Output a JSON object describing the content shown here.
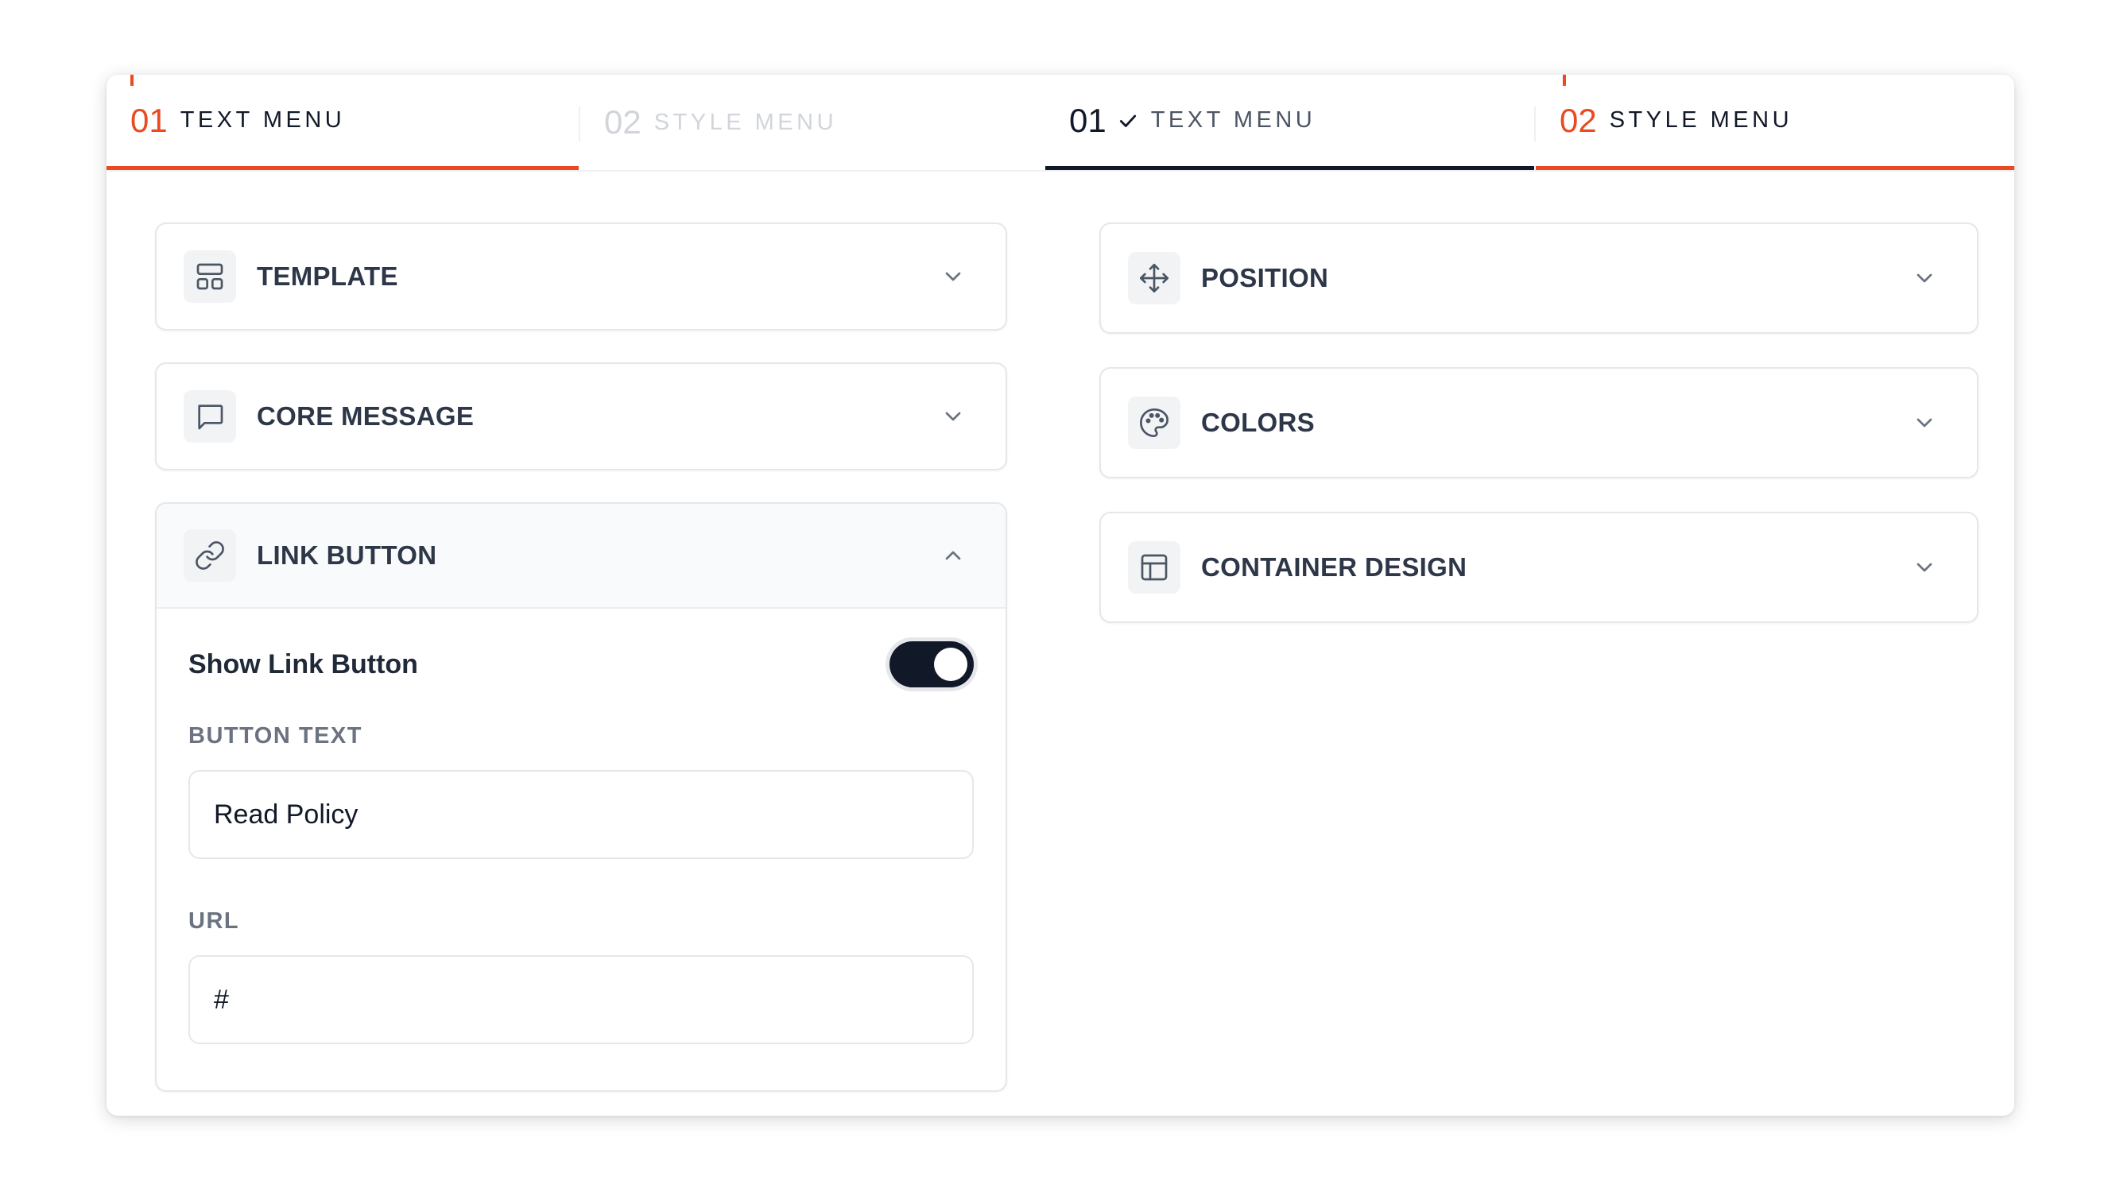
{
  "left_panel": {
    "tabs": [
      {
        "num": "01",
        "label": "TEXT MENU"
      },
      {
        "num": "02",
        "label": "STYLE MENU"
      }
    ],
    "sections": {
      "template": {
        "title": "TEMPLATE",
        "icon": "layout-template-icon"
      },
      "core_message": {
        "title": "CORE MESSAGE",
        "icon": "message-square-icon"
      },
      "link_button": {
        "title": "LINK BUTTON",
        "icon": "link-icon",
        "show_label": "Show Link Button",
        "show_enabled": true,
        "button_text_label": "BUTTON TEXT",
        "button_text_value": "Read Policy",
        "url_label": "URL",
        "url_value": "#"
      }
    }
  },
  "right_panel": {
    "tabs": [
      {
        "num": "01",
        "label": "TEXT MENU",
        "completed": true
      },
      {
        "num": "02",
        "label": "STYLE MENU"
      }
    ],
    "sections": {
      "position": {
        "title": "POSITION",
        "icon": "move-icon"
      },
      "colors": {
        "title": "COLORS",
        "icon": "palette-icon"
      },
      "container_design": {
        "title": "CONTAINER DESIGN",
        "icon": "layout-panel-icon"
      }
    }
  },
  "colors": {
    "accent": "#ea4a1f",
    "dark": "#111827",
    "muted": "#d1d5db"
  }
}
